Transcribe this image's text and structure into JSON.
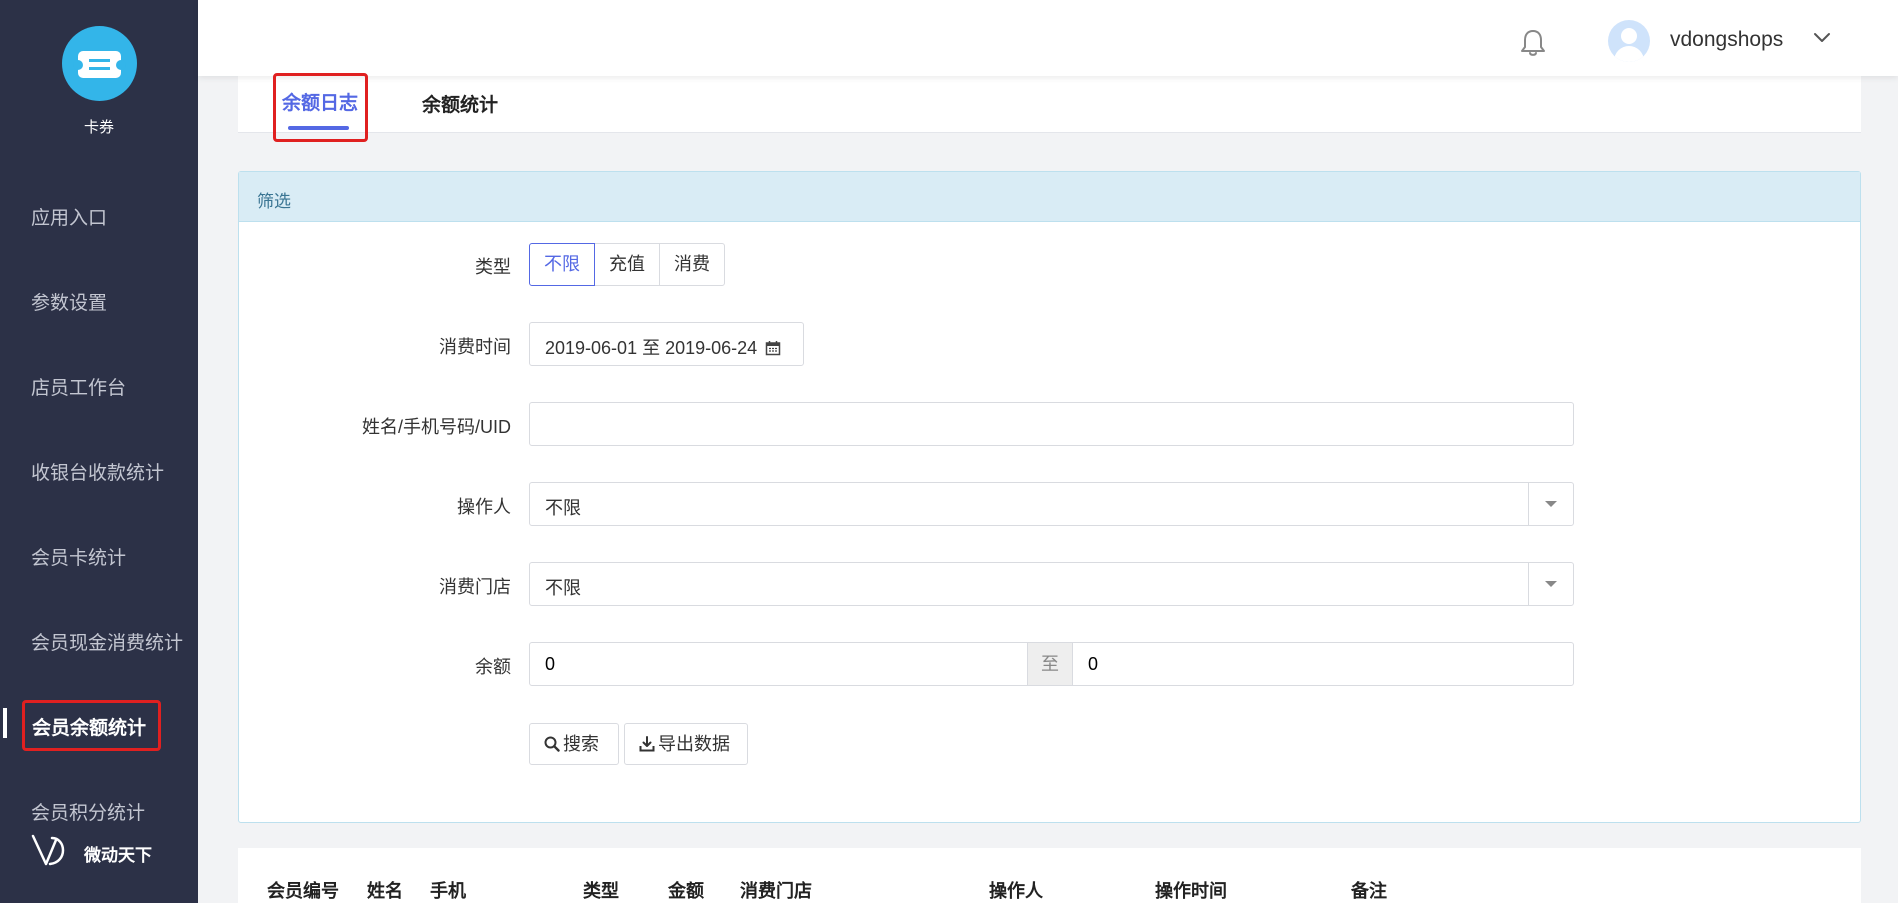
{
  "sidebar": {
    "app_name": "卡券",
    "items": [
      {
        "label": "应用入口"
      },
      {
        "label": "参数设置"
      },
      {
        "label": "店员工作台"
      },
      {
        "label": "收银台收款统计"
      },
      {
        "label": "会员卡统计"
      },
      {
        "label": "会员现金消费统计"
      },
      {
        "label": "会员余额统计",
        "active": true
      },
      {
        "label": "会员积分统计"
      }
    ],
    "brand_name": "微动天下"
  },
  "header": {
    "username": "vdongshops",
    "icons": [
      "bell-icon",
      "avatar",
      "chevron-down-icon"
    ]
  },
  "tabs": [
    {
      "label": "余额日志",
      "active": true
    },
    {
      "label": "余额统计"
    }
  ],
  "filter": {
    "heading": "筛选",
    "type_label": "类型",
    "type_options": [
      "不限",
      "充值",
      "消费"
    ],
    "type_selected": "不限",
    "time_label": "消费时间",
    "time_value": "2019-06-01 至 2019-06-24",
    "search_label": "姓名/手机号码/UID",
    "search_value": "",
    "operator_label": "操作人",
    "operator_value": "不限",
    "store_label": "消费门店",
    "store_value": "不限",
    "balance_label": "余额",
    "balance_from": "0",
    "balance_sep": "至",
    "balance_to": "0",
    "search_button": "搜索",
    "export_button": "导出数据"
  },
  "table": {
    "columns": [
      "会员编号",
      "姓名",
      "手机",
      "类型",
      "金额",
      "消费门店",
      "操作人",
      "操作时间",
      "备注"
    ]
  },
  "colors": {
    "sidebar_bg": "#2c3147",
    "accent": "#5468e4",
    "highlight": "#e02020",
    "panel_heading_bg": "#d9ecf5"
  }
}
